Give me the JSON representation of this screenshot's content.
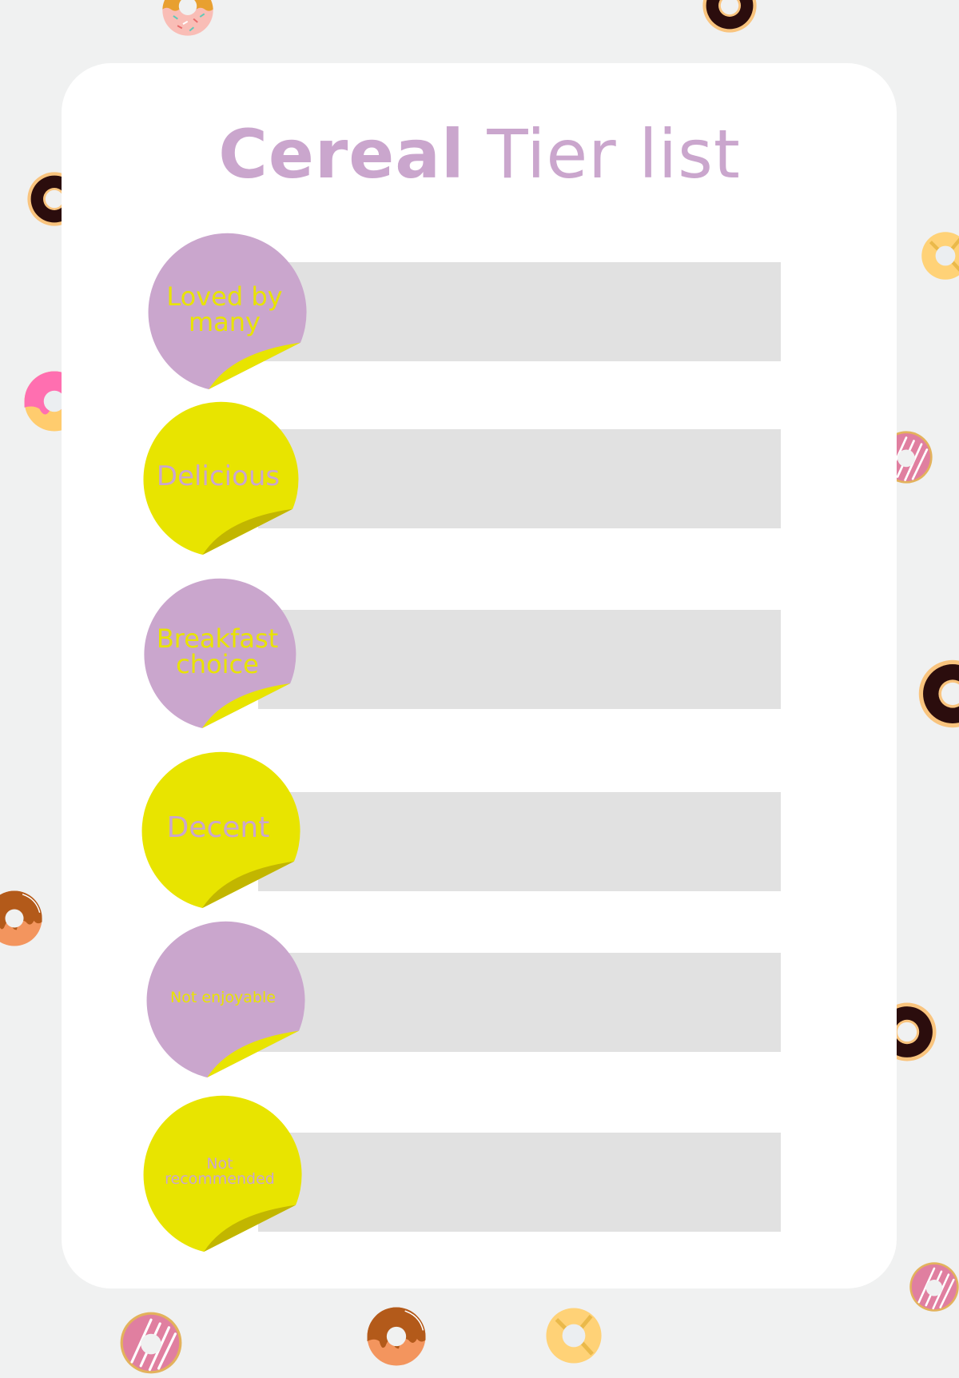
{
  "title": {
    "bold": "Cereal",
    "light": "Tier list"
  },
  "colors": {
    "background": "#f0f1f1",
    "card": "#ffffff",
    "purple": "#caa6cd",
    "yellow": "#e8e400",
    "yellow_shadow": "#c2b600",
    "bar": "#e1e1e1"
  },
  "tiers": [
    {
      "label": "Loved by many",
      "lines": [
        "Loved by",
        "many"
      ],
      "sticker_color": "purple",
      "text_color": "yellow",
      "items": []
    },
    {
      "label": "Delicious",
      "lines": [
        "Delicious"
      ],
      "sticker_color": "yellow",
      "text_color": "purple",
      "items": []
    },
    {
      "label": "Breakfast choice",
      "lines": [
        "Breakfast",
        "choice"
      ],
      "sticker_color": "purple",
      "text_color": "yellow",
      "items": []
    },
    {
      "label": "Decent",
      "lines": [
        "Decent"
      ],
      "sticker_color": "yellow",
      "text_color": "purple",
      "items": []
    },
    {
      "label": "Not enjoyable",
      "lines": [
        "Not enjoyable"
      ],
      "sticker_color": "purple",
      "text_color": "yellow",
      "items": []
    },
    {
      "label": "Not recommended",
      "lines": [
        "Not",
        "recommended"
      ],
      "sticker_color": "yellow",
      "text_color": "purple",
      "items": []
    }
  ],
  "decorations": [
    {
      "icon": "strawberry-sprinkle-donut-icon"
    },
    {
      "icon": "chocolate-donut-icon"
    },
    {
      "icon": "pink-glazed-donut-icon"
    },
    {
      "icon": "yellow-ring-donut-icon"
    },
    {
      "icon": "pink-striped-donut-icon"
    },
    {
      "icon": "caramel-donut-icon"
    }
  ]
}
